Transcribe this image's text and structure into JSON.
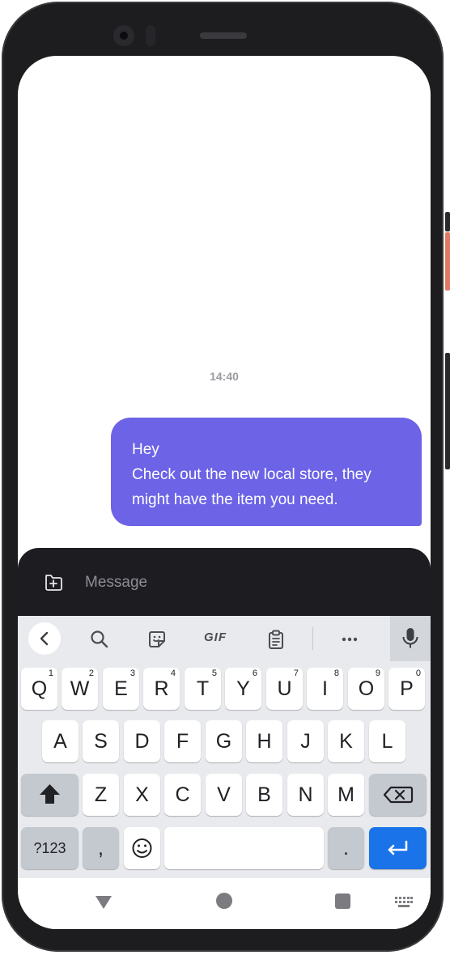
{
  "conversation": {
    "timestamp": "14:40",
    "message": {
      "lines": [
        "Hey",
        "Check out the new local store, they",
        "might have the item you need."
      ]
    },
    "bubble_color": "#6c63e6"
  },
  "compose": {
    "placeholder": "Message"
  },
  "keyboard": {
    "toolbar": {
      "back_icon": "chevron-left-icon",
      "search_icon": "search-icon",
      "sticker_icon": "sticker-icon",
      "gif_label": "GIF",
      "clipboard_icon": "clipboard-icon",
      "more_icon": "more-horizontal-icon",
      "mic_icon": "microphone-icon"
    },
    "row1": [
      {
        "label": "Q",
        "hint": "1"
      },
      {
        "label": "W",
        "hint": "2"
      },
      {
        "label": "E",
        "hint": "3"
      },
      {
        "label": "R",
        "hint": "4"
      },
      {
        "label": "T",
        "hint": "5"
      },
      {
        "label": "Y",
        "hint": "6"
      },
      {
        "label": "U",
        "hint": "7"
      },
      {
        "label": "I",
        "hint": "8"
      },
      {
        "label": "O",
        "hint": "9"
      },
      {
        "label": "P",
        "hint": "0"
      }
    ],
    "row2": [
      "A",
      "S",
      "D",
      "F",
      "G",
      "H",
      "J",
      "K",
      "L"
    ],
    "row3": [
      "Z",
      "X",
      "C",
      "V",
      "B",
      "N",
      "M"
    ],
    "row4": {
      "symbols_label": "?123",
      "comma_label": ",",
      "period_label": "."
    },
    "accent_color": "#1a73e8"
  },
  "navbar": {
    "back_icon": "triangle-back-icon",
    "home_icon": "circle-home-icon",
    "recents_icon": "square-recents-icon",
    "keyboard_icon": "keyboard-switch-icon"
  }
}
